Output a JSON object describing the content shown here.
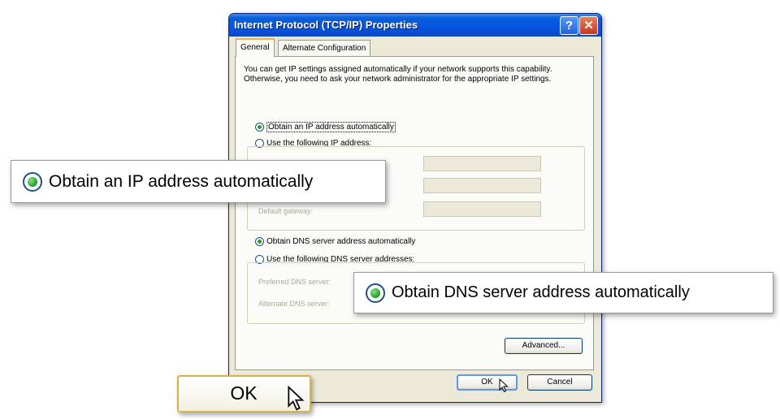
{
  "dialog": {
    "title": "Internet Protocol (TCP/IP) Properties",
    "help_glyph": "?",
    "close_glyph": "✕",
    "tabs": [
      {
        "label": "General",
        "active": true
      },
      {
        "label": "Alternate Configuration",
        "active": false
      }
    ],
    "description": "You can get IP settings assigned automatically if your network supports this capability. Otherwise, you need to ask your network administrator for the appropriate IP settings.",
    "ip": {
      "auto_label": "Obtain an IP address automatically",
      "manual_label": "Use the following IP address:",
      "gateway_label": "Default gateway:",
      "selected": "auto"
    },
    "dns": {
      "auto_label": "Obtain DNS server address automatically",
      "manual_label": "Use the following DNS server addresses:",
      "preferred_label": "Preferred DNS server:",
      "alternate_label": "Alternate DNS server:",
      "selected": "auto"
    },
    "advanced_label": "Advanced...",
    "ok_label": "OK",
    "cancel_label": "Cancel"
  },
  "callouts": {
    "ip_auto": "Obtain an IP address automatically",
    "dns_auto": "Obtain DNS server address automatically",
    "ok": "OK"
  },
  "icons": {
    "cursor": "arrow-cursor-icon",
    "radio_selected_color": "#21a121"
  }
}
